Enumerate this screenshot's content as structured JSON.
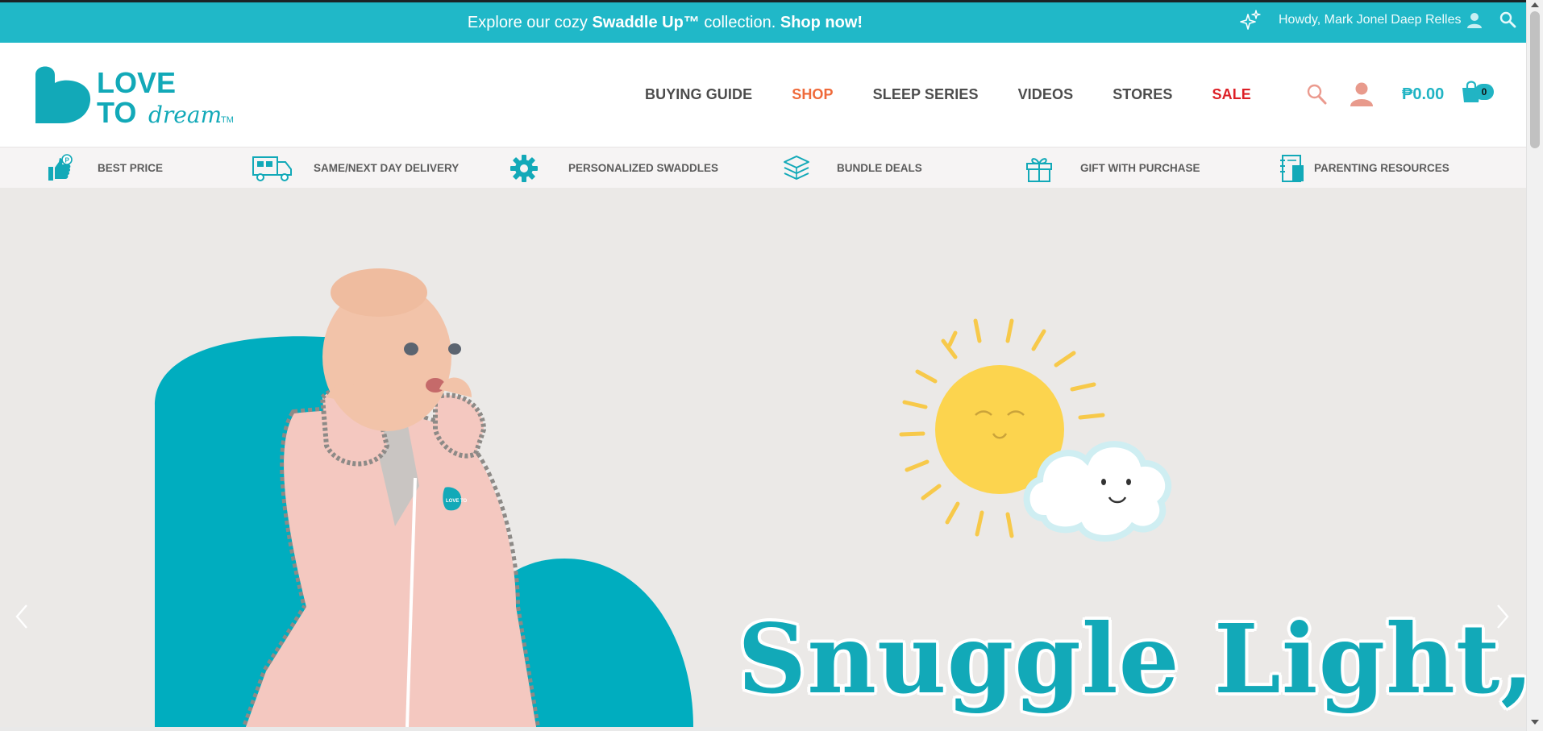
{
  "announcement": {
    "prefix": "Explore our cozy ",
    "highlight": "Swaddle Up™",
    "middle": " collection. ",
    "cta": "Shop now!",
    "greeting": "Howdy, Mark Jonel Daep Relles",
    "icons": [
      "sparkle-icon",
      "user-icon",
      "search-icon"
    ]
  },
  "logo": {
    "line1": "LOVE",
    "line2": "TO",
    "script": "dream",
    "tm": "TM",
    "color": "#12a9b8"
  },
  "nav": {
    "items": [
      {
        "label": "BUYING GUIDE"
      },
      {
        "label": "SHOP"
      },
      {
        "label": "SLEEP SERIES"
      },
      {
        "label": "VIDEOS"
      },
      {
        "label": "STORES"
      },
      {
        "label": "SALE"
      }
    ],
    "shop_color": "#ef6a3a",
    "sale_color": "#dd1f26"
  },
  "cart": {
    "total": "₱0.00",
    "count": "0"
  },
  "usp": {
    "items": [
      {
        "label": "BEST PRICE",
        "icon": "thumbs-up-price-icon"
      },
      {
        "label": "SAME/NEXT DAY DELIVERY",
        "icon": "delivery-truck-icon"
      },
      {
        "label": "PERSONALIZED SWADDLES",
        "icon": "gear-icon"
      },
      {
        "label": "BUNDLE DEALS",
        "icon": "stack-icon"
      },
      {
        "label": "GIFT WITH PURCHASE",
        "icon": "gift-icon"
      },
      {
        "label": "PARENTING RESOURCES",
        "icon": "notebook-icon"
      }
    ]
  },
  "hero": {
    "headline": "Snuggle Light,",
    "badge": "LOVE TO",
    "accent": "#00adbf",
    "background": "#ebe9e7"
  }
}
